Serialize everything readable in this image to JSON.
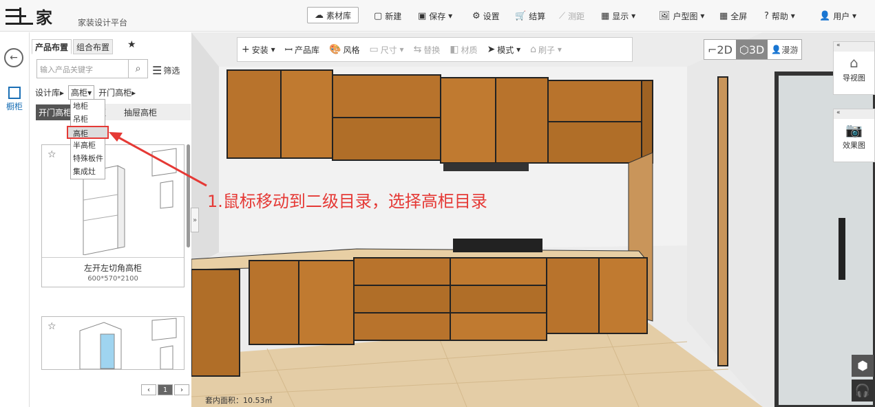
{
  "brand": {
    "name": "家",
    "platform": "家装设计平台"
  },
  "toolbar": {
    "material": "素材库",
    "new": "新建",
    "save": "保存",
    "settings": "设置",
    "checkout": "结算",
    "measure": "测距",
    "display": "显示",
    "floorplan": "户型图",
    "fullscreen": "全屏",
    "help": "帮助",
    "user": "用户"
  },
  "rail": {
    "cabinet": "橱柜"
  },
  "panel": {
    "tabs": [
      "产品布置",
      "组合布置"
    ],
    "search_placeholder": "输入产品关键字",
    "filter": "筛选",
    "crumbs": {
      "library": "设计库",
      "level2": "高柜",
      "level3": "开门高柜"
    },
    "subcats": [
      "开门高柜",
      "高柜",
      "抽屉高柜"
    ],
    "dropdown": [
      "地柜",
      "吊柜",
      "高柜",
      "半高柜",
      "特殊板件",
      "集成灶"
    ],
    "selected_dropdown": "高柜",
    "products": [
      {
        "name": "左开左切角高柜",
        "size": "600*570*2100"
      }
    ],
    "page": "1"
  },
  "toolbar2": [
    "安装",
    "产品库",
    "风格",
    "尺寸",
    "替换",
    "材质",
    "模式",
    "刷子"
  ],
  "viewmodes": [
    "2D",
    "3D",
    "漫游"
  ],
  "right_panel": {
    "nav": "导视图",
    "render": "效果图"
  },
  "status": {
    "area": "套内面积：10.53㎡"
  },
  "annotation": "1.鼠标移动到二级目录，选择高柜目录",
  "colors": {
    "annotation": "#e53935",
    "wood": "#b8732c",
    "floor": "#e4cda6"
  }
}
